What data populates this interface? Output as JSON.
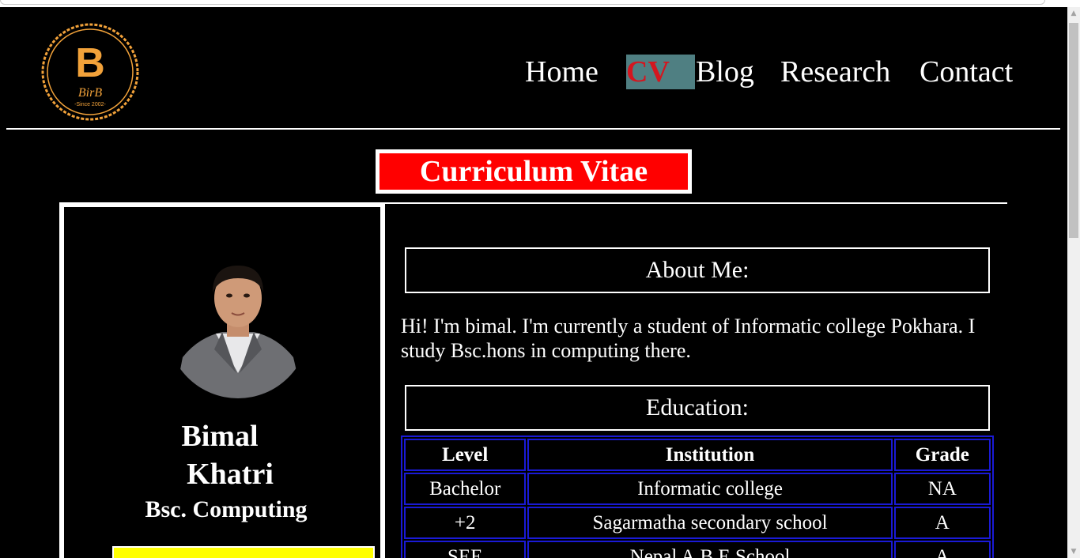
{
  "logo": {
    "letter": "B",
    "brand": "BirB",
    "since": "-Since 2002-"
  },
  "nav": {
    "items": [
      {
        "label": "Home",
        "active": false
      },
      {
        "label": "CV",
        "active": true
      },
      {
        "label": "Blog",
        "active": false
      },
      {
        "label": "Research",
        "active": false
      },
      {
        "label": "Contact",
        "active": false
      }
    ]
  },
  "page_title": "Curriculum Vitae",
  "profile": {
    "first_name": "Bimal",
    "last_name": "Khatri",
    "degree": "Bsc. Computing"
  },
  "about": {
    "heading": "About Me:",
    "text": "Hi! I'm bimal. I'm currently a student of Informatic college Pokhara. I study Bsc.hons in computing there."
  },
  "education": {
    "heading": "Education:",
    "columns": [
      "Level",
      "Institution",
      "Grade"
    ],
    "rows": [
      {
        "level": "Bachelor",
        "institution": "Informatic college",
        "grade": "NA"
      },
      {
        "level": "+2",
        "institution": "Sagarmatha secondary school",
        "grade": "A"
      },
      {
        "level": "SEE",
        "institution": "Nepal A.B.E School",
        "grade": "A"
      }
    ]
  },
  "colors": {
    "background": "#000000",
    "title_red": "#ff0000",
    "nav_active_bg": "#4f7f82",
    "nav_active_text": "#d4161f",
    "table_border": "#1a1ad6",
    "logo_orange": "#f2a23a",
    "accent_yellow": "#ffff00"
  }
}
